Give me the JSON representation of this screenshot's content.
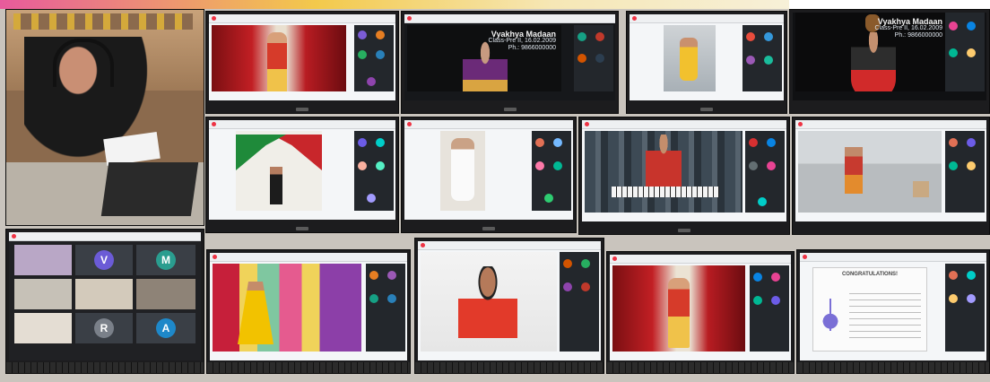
{
  "collage": {
    "tiles": [
      {
        "id": "host",
        "description_label": "Teacher at desk with headset"
      },
      {
        "id": "t2"
      },
      {
        "id": "t3"
      },
      {
        "id": "t4"
      },
      {
        "id": "t5"
      },
      {
        "id": "t6"
      },
      {
        "id": "t7"
      },
      {
        "id": "t8"
      },
      {
        "id": "t9"
      },
      {
        "id": "t10"
      },
      {
        "id": "t11"
      },
      {
        "id": "t12"
      },
      {
        "id": "t13"
      },
      {
        "id": "t14"
      }
    ],
    "overlay_t3": {
      "name": "Vyakhya Madaan",
      "line2": "Class-Pre II, 16.02.2009",
      "line3": "Ph.: 9866000000"
    },
    "overlay_t5": {
      "name": "Vyakhya Madaan",
      "line2": "Class-Pre II, 16.02.2009",
      "line3": "Ph.: 9866000000"
    },
    "meet_letters": [
      "V",
      "M",
      "R",
      "A"
    ],
    "certificate": {
      "title": "CONGRATULATIONS!"
    }
  },
  "colors": {
    "brand_pink": "#d7347c",
    "meet_dark": "#23272c",
    "letter_v": "#6b5bd6",
    "letter_m": "#2a9d8f",
    "letter_r": "#7a8089",
    "letter_a": "#1e88c9"
  }
}
